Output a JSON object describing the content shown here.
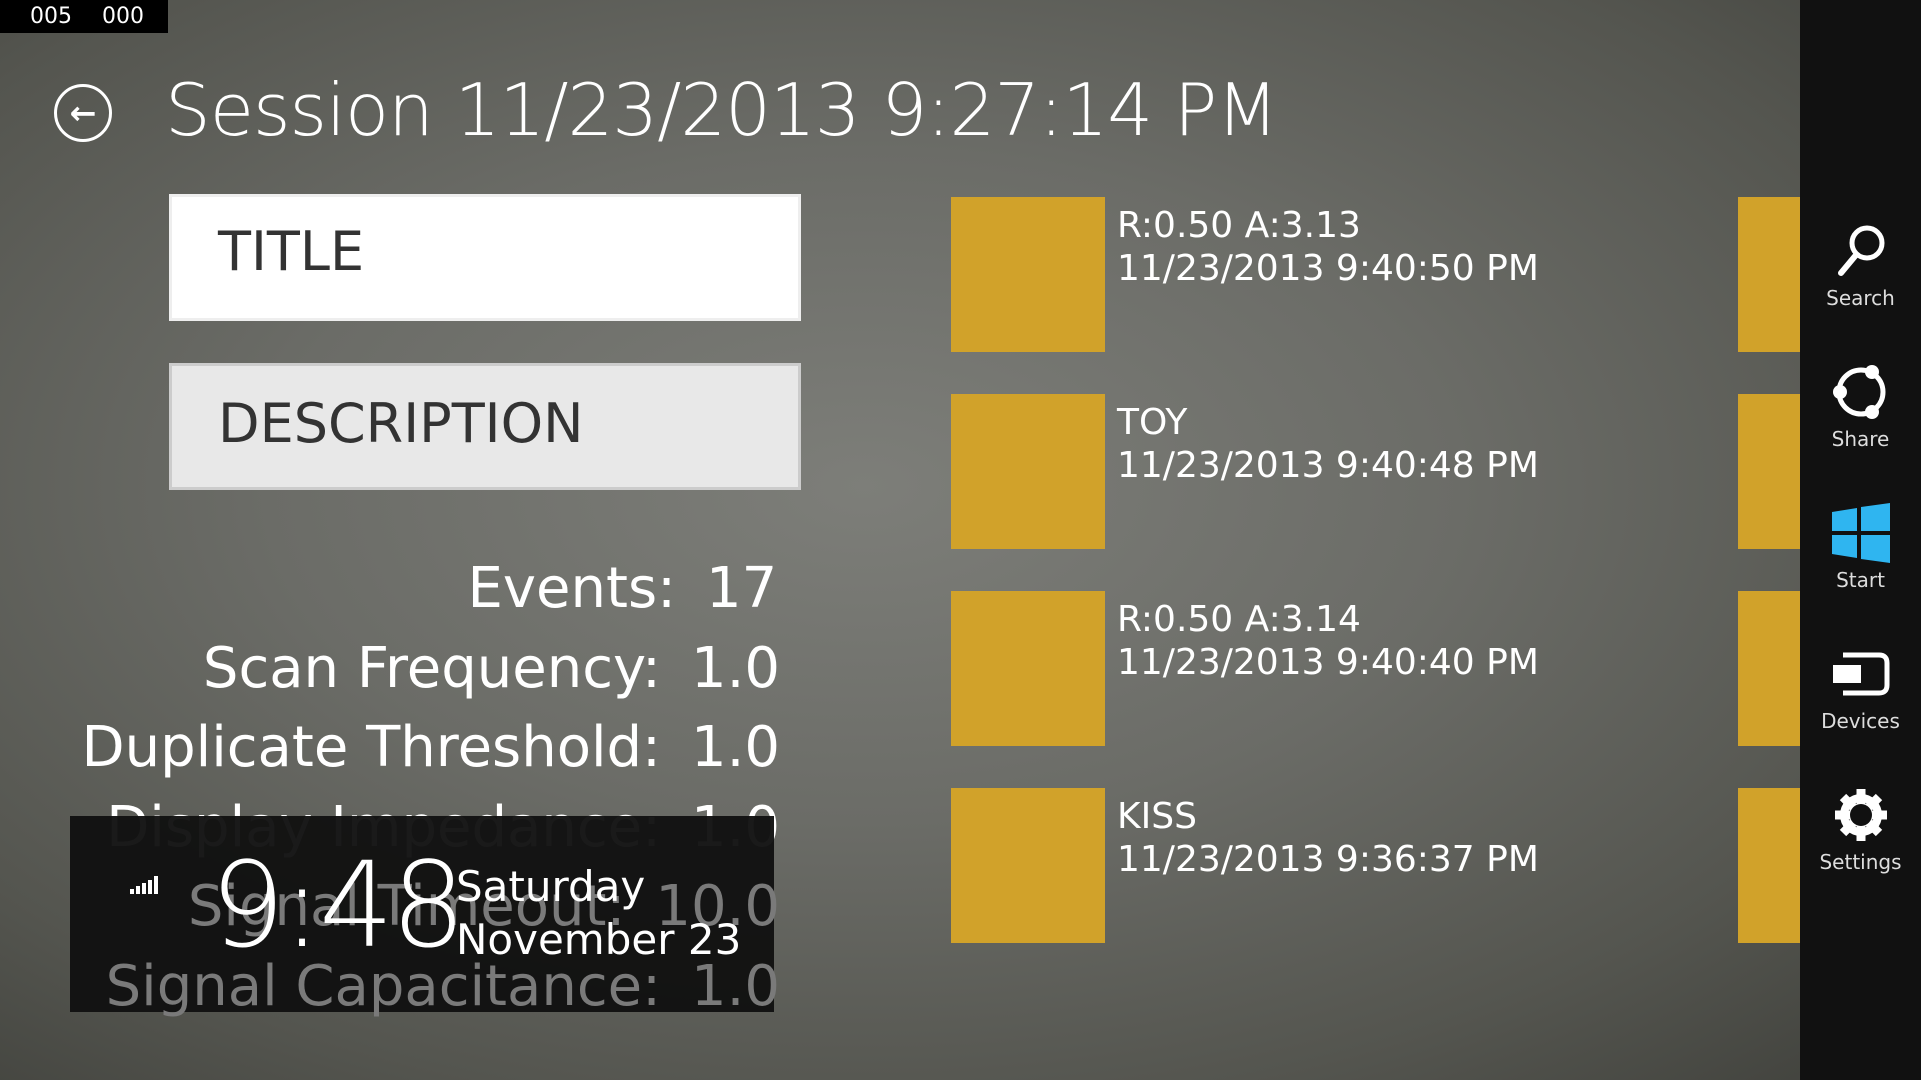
{
  "counter": [
    "005",
    "000"
  ],
  "header": {
    "title": "Session 11/23/2013 9:27:14 PM"
  },
  "form": {
    "title_placeholder": "TITLE",
    "description_placeholder": "DESCRIPTION"
  },
  "stats": [
    {
      "label": "Events:",
      "value": "17"
    },
    {
      "label": "Scan Frequency:",
      "value": "1.0"
    },
    {
      "label": "Duplicate Threshold:",
      "value": "1.0"
    },
    {
      "label": "Display Impedance:",
      "value": "1.0"
    },
    {
      "label": "Signal Timeout:",
      "value": "10.0"
    },
    {
      "label": "Signal Capacitance:",
      "value": "1.0"
    }
  ],
  "clock": {
    "time": "9:48",
    "day": "Saturday",
    "date": "November 23"
  },
  "events": [
    {
      "name": "R:0.50 A:3.13",
      "time": "11/23/2013 9:40:50 PM"
    },
    {
      "name": "TOY",
      "time": "11/23/2013 9:40:48 PM"
    },
    {
      "name": "R:0.50 A:3.14",
      "time": "11/23/2013 9:40:40 PM"
    },
    {
      "name": "KISS",
      "time": "11/23/2013 9:36:37 PM"
    }
  ],
  "charms": [
    {
      "label": "Search"
    },
    {
      "label": "Share"
    },
    {
      "label": "Start"
    },
    {
      "label": "Devices"
    },
    {
      "label": "Settings"
    }
  ],
  "colors": {
    "tile": "#d1a22a",
    "charm_bar": "#111111",
    "start_icon": "#2fb5f0"
  }
}
